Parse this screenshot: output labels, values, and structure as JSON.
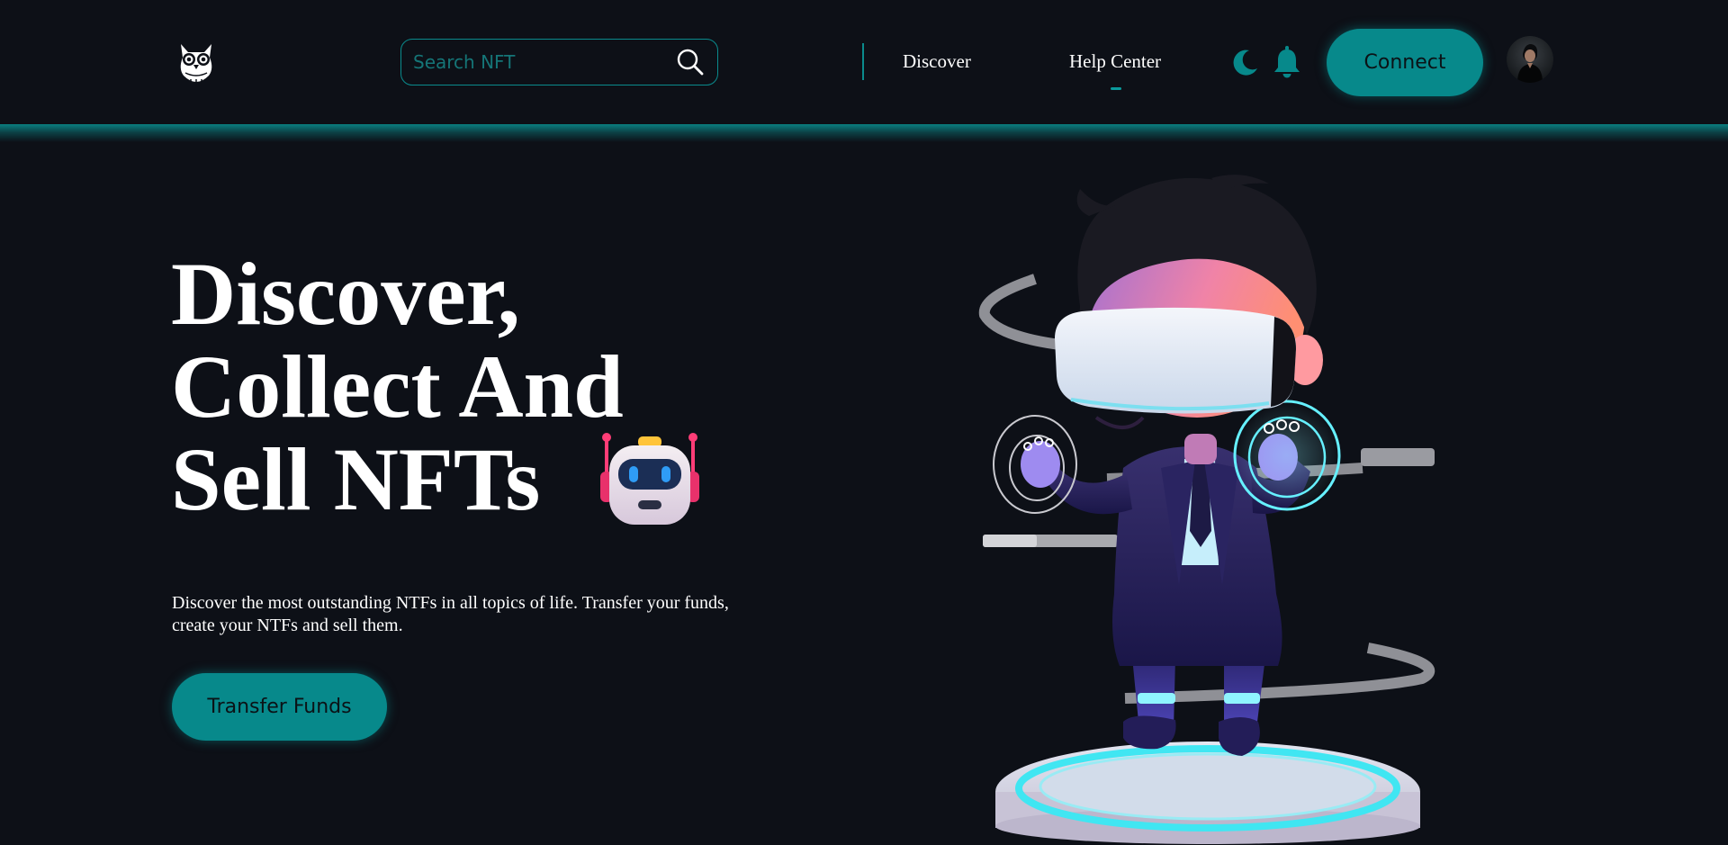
{
  "header": {
    "logo_icon": "owl-icon",
    "search": {
      "placeholder": "Search NFT",
      "value": "",
      "icon": "search-icon"
    },
    "nav": [
      {
        "label": "Discover",
        "active": false
      },
      {
        "label": "Help Center",
        "active": true
      }
    ],
    "theme_icon": "moon-icon",
    "notification_icon": "bell-icon",
    "connect_label": "Connect",
    "avatar_icon": "user-avatar"
  },
  "hero": {
    "title_lines": [
      "Discover,",
      "Collect And",
      "Sell NFTs"
    ],
    "emoji_icon": "robot-icon",
    "description": "Discover the most outstanding NTFs in all topics of life. Transfer your funds, create your NTFs and sell them.",
    "cta_label": "Transfer Funds",
    "illustration": "vr-character-illustration"
  },
  "colors": {
    "background": "#0d1017",
    "accent": "#07898b",
    "accent_border": "#0a8b8d",
    "text": "#ffffff",
    "button_text": "#0b1216"
  }
}
